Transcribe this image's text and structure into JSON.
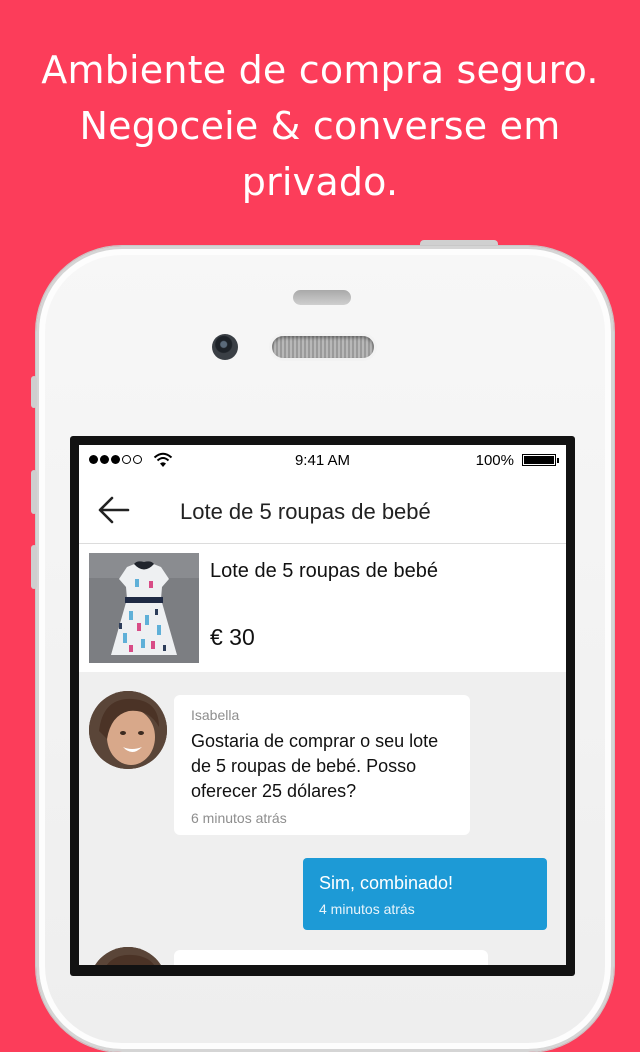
{
  "headline": {
    "line1": "Ambiente de compra seguro.",
    "line2": "Negoceie & converse em",
    "line3": "privado."
  },
  "status_bar": {
    "time": "9:41 AM",
    "battery": "100%"
  },
  "navbar": {
    "title": "Lote de 5 roupas de bebé",
    "back_icon": "arrow-left-icon"
  },
  "product": {
    "title": "Lote de 5 roupas de bebé",
    "price": "€ 30",
    "image": "baby-dress-photo"
  },
  "messages": [
    {
      "sender": "Isabella",
      "text": "Gostaria de comprar o seu lote de 5 roupas de bebé. Posso oferecer 25 dólares?",
      "time": "6 minutos atrás",
      "direction": "incoming"
    },
    {
      "text": "Sim, combinado!",
      "time": "4 minutos atrás",
      "direction": "outgoing"
    }
  ],
  "colors": {
    "background": "#fc3d5a",
    "outgoing_bubble": "#1d9ad6"
  }
}
